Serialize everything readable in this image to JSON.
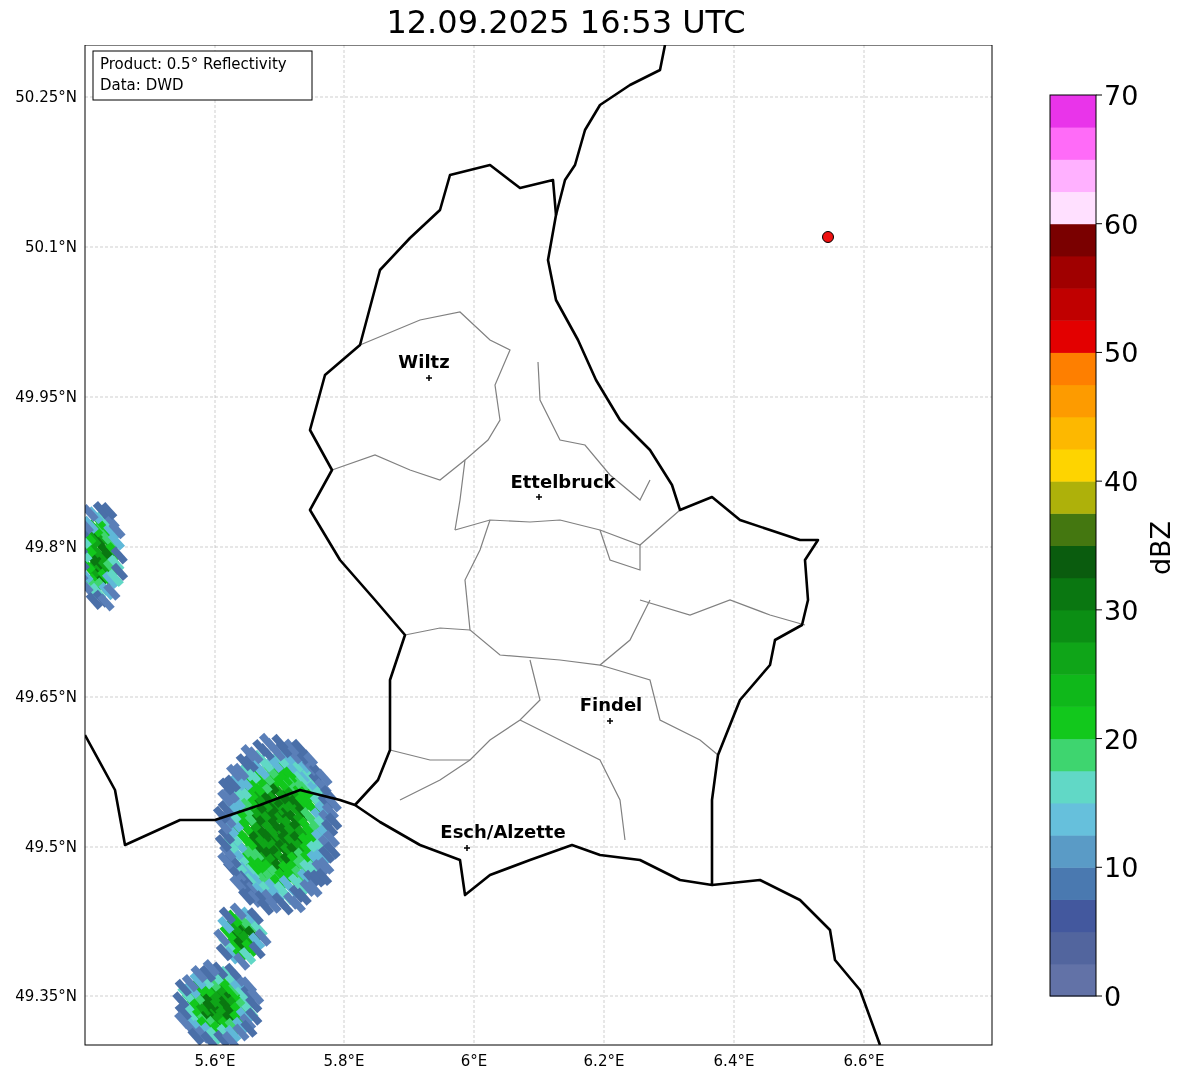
{
  "title": "12.09.2025 16:53 UTC",
  "info_box": [
    "Product: 0.5° Reflectivity",
    "Data: DWD"
  ],
  "y_ticks": [
    "50.25°N",
    "50.1°N",
    "49.95°N",
    "49.8°N",
    "49.65°N",
    "49.5°N",
    "49.35°N"
  ],
  "x_ticks": [
    "5.6°E",
    "5.8°E",
    "6°E",
    "6.2°E",
    "6.4°E",
    "6.6°E"
  ],
  "cities": [
    "Wiltz",
    "Ettelbruck",
    "Findel",
    "Esch/Alzette"
  ],
  "colorbar": {
    "label": "dBZ",
    "ticks": [
      "70",
      "60",
      "50",
      "40",
      "30",
      "20",
      "10",
      "0"
    ],
    "bins": [
      {
        "color": "#6272a7"
      },
      {
        "color": "#52659e"
      },
      {
        "color": "#43589e"
      },
      {
        "color": "#4a79b0"
      },
      {
        "color": "#5a9bc6"
      },
      {
        "color": "#66c0dc"
      },
      {
        "color": "#61d8c6"
      },
      {
        "color": "#3ed56f"
      },
      {
        "color": "#12c81c"
      },
      {
        "color": "#0fb81a"
      },
      {
        "color": "#0fa518"
      },
      {
        "color": "#0b8e14"
      },
      {
        "color": "#0a7711"
      },
      {
        "color": "#0a5c0e"
      },
      {
        "color": "#447710"
      },
      {
        "color": "#aeb10a"
      },
      {
        "color": "#fed400"
      },
      {
        "color": "#fdb800"
      },
      {
        "color": "#fd9b00"
      },
      {
        "color": "#fe7f00"
      },
      {
        "color": "#e30000"
      },
      {
        "color": "#c00000"
      },
      {
        "color": "#a00000"
      },
      {
        "color": "#7a0000"
      },
      {
        "color": "#ffe0ff"
      },
      {
        "color": "#ffb1ff"
      },
      {
        "color": "#ff6bf8"
      },
      {
        "color": "#e934ea"
      }
    ]
  }
}
